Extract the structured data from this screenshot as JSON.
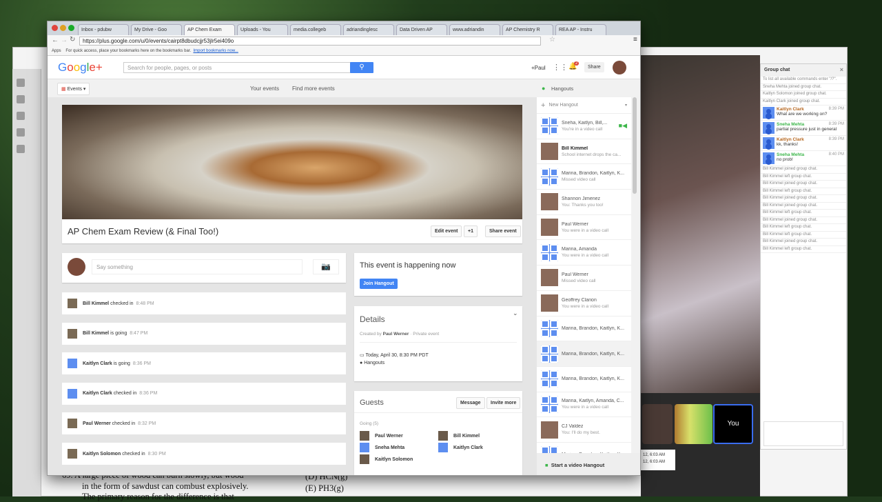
{
  "browser": {
    "tabs": [
      "Inbox - pdubw",
      "My Drive - Goo",
      "AP Chem Exam",
      "Uploads - You",
      "media.collegeb",
      "adriandinglesc",
      "Data Driven AP",
      "www.adriandin",
      "AP Chemistry R",
      "REA AP - Instru"
    ],
    "url": "https://plus.google.com/u/0/events/cairpt8dbudcjjr53jlr5ei409o",
    "bookmarks": {
      "apps": "Apps",
      "hint": "For quick access, place your bookmarks here on the bookmarks bar.",
      "import": "Import bookmarks now..."
    }
  },
  "gplus": {
    "logo": "Google+",
    "search_placeholder": "Search for people, pages, or posts",
    "user": "+Paul",
    "notifications": "2",
    "share": "Share",
    "events_menu": "Events",
    "nav": [
      "Your events",
      "Find more events"
    ]
  },
  "event": {
    "title": "AP Chem Exam Review (& Final Too!)",
    "actions": [
      "Edit event",
      "+1",
      "Share event"
    ],
    "say_placeholder": "Say something",
    "happening": "This event is happening now",
    "join": "Join Hangout",
    "details": {
      "heading": "Details",
      "created_by": "Created by",
      "creator": "Paul Werner",
      "privacy": "Private event",
      "when": "Today, April 30, 8:30 PM PDT",
      "where": "Hangouts"
    },
    "guests": {
      "heading": "Guests",
      "message": "Message",
      "invite": "Invite more",
      "going": "Going (5)",
      "list": [
        "Paul Werner",
        "Bill Kimmel",
        "Sneha Mehta",
        "Kaitlyn Clark",
        "Kaitlyn Solomon"
      ]
    },
    "activity": [
      {
        "name": "Bill Kimmel",
        "action": "checked in",
        "time": "8:48 PM"
      },
      {
        "name": "Bill Kimmel",
        "action": "is going",
        "time": "8:47 PM"
      },
      {
        "name": "Kaitlyn Clark",
        "action": "is going",
        "time": "8:36 PM"
      },
      {
        "name": "Kaitlyn Clark",
        "action": "checked in",
        "time": "8:36 PM"
      },
      {
        "name": "Paul Werner",
        "action": "checked in",
        "time": "8:32 PM"
      },
      {
        "name": "Kaitlyn Solomon",
        "action": "checked in",
        "time": "8:30 PM"
      }
    ]
  },
  "hangouts": {
    "title": "Hangouts",
    "new": "New Hangout",
    "start_video": "Start a video Hangout",
    "items": [
      {
        "name": "Sneha, Kaitlyn, Bill,...",
        "status": "You're in a video call"
      },
      {
        "name": "Bill Kimmel",
        "status": "School internet drops the ca..."
      },
      {
        "name": "Marina, Brandon, Kaitlyn, K...",
        "status": "Missed video call"
      },
      {
        "name": "Shannon Jimenez",
        "status": "You: Thanks you too!"
      },
      {
        "name": "Paul Werner",
        "status": "You were in a video call"
      },
      {
        "name": "Marina, Amanda",
        "status": "You were in a video call"
      },
      {
        "name": "Paul Werner",
        "status": "Missed video call"
      },
      {
        "name": "Geoffrey Clarion",
        "status": "You were in a video call"
      },
      {
        "name": "Marina, Brandon, Kaitlyn, K...",
        "status": ""
      },
      {
        "name": "Marina, Brandon, Kaitlyn, K...",
        "status": ""
      },
      {
        "name": "Marina, Brandon, Kaitlyn, K...",
        "status": ""
      },
      {
        "name": "Marina, Kaitlyn, Amanda, C...",
        "status": "You were in a video call"
      },
      {
        "name": "CJ Valdez",
        "status": "You: I'll do my best."
      },
      {
        "name": "Marina, Brandon, Kaitlyn, K...",
        "status": ""
      }
    ]
  },
  "group_chat": {
    "title": "Group chat",
    "system_top": [
      "To list all available commands enter \"/?\".",
      "Sneha Mehta joined group chat.",
      "Kaitlyn Solomon joined group chat.",
      "Kaitlyn Clark joined group chat."
    ],
    "messages": [
      {
        "name": "Kaitlyn Clark",
        "time": "8:39 PM",
        "text": "What are we working on?",
        "color": "#b5651d"
      },
      {
        "name": "Sneha Mehta",
        "time": "8:39 PM",
        "text": "partial pressure just in general",
        "color": "#3cb64a"
      },
      {
        "name": "Kaitlyn Clark",
        "time": "8:39 PM",
        "text": "kk, thanks!",
        "color": "#b5651d"
      },
      {
        "name": "Sneha Mehta",
        "time": "8:40 PM",
        "text": "no prob!",
        "color": "#3cb64a"
      }
    ],
    "system_bottom": [
      "Bill Kimmel joined group chat.",
      "Bill Kimmel left group chat.",
      "Bill Kimmel joined group chat.",
      "Bill Kimmel left group chat.",
      "Bill Kimmel joined group chat.",
      "Bill Kimmel joined group chat.",
      "Bill Kimmel left group chat.",
      "Bill Kimmel joined group chat.",
      "Bill Kimmel left group chat.",
      "Bill Kimmel left group chat.",
      "Bill Kimmel joined group chat.",
      "Bill Kimmel left group chat."
    ]
  },
  "video": {
    "you_label": "You",
    "timestamps": [
      "12, 6:03 AM",
      "12, 6:03 AM"
    ]
  },
  "background_doc": {
    "line1": "69. A large piece of wood can burn slowly, but wood",
    "line2": "in the form of sawdust can combust explosively.",
    "line3": "The primary reason for the difference is that",
    "opt_d": "(D)  HCN(g)",
    "opt_e": "(E)  PH3(g)"
  },
  "colors": {
    "accent": "#4285f4",
    "hangout_green": "#3cb64a"
  }
}
